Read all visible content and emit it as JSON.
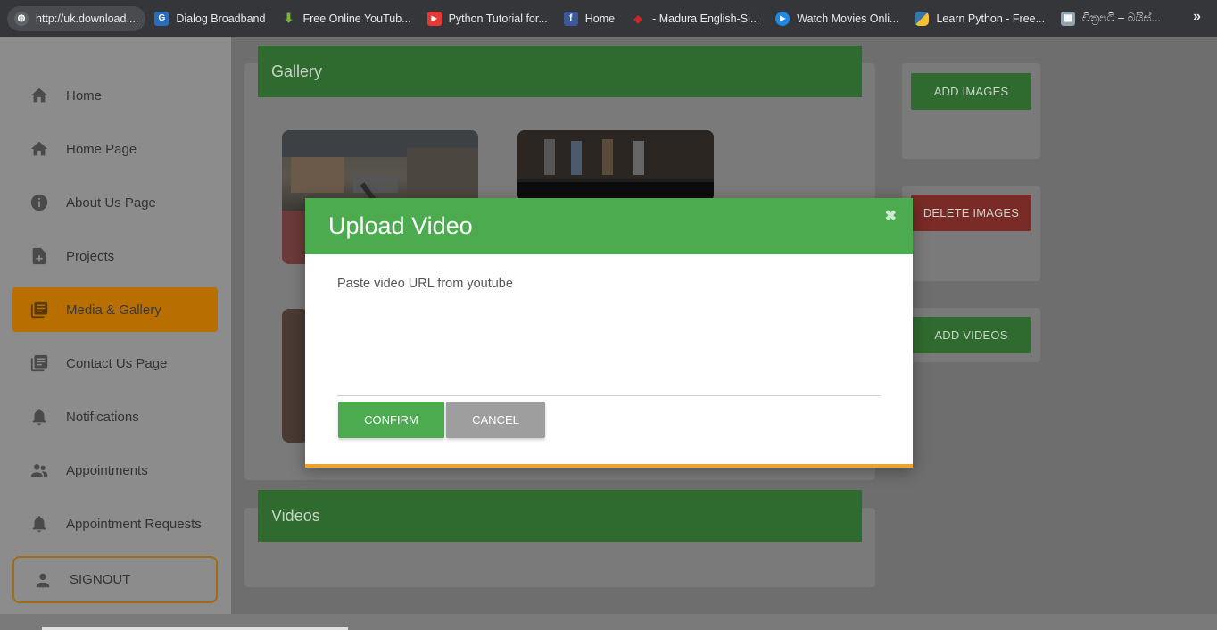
{
  "bookmarks": [
    {
      "label": "http://uk.download....",
      "icon": "globe-icon",
      "color": "#5f6368"
    },
    {
      "label": "Dialog Broadband",
      "icon": "dialog-icon",
      "color": "#2a6ebb"
    },
    {
      "label": "Free Online YouTub...",
      "icon": "download-arrow-icon",
      "color": "#7cb342"
    },
    {
      "label": "Python Tutorial for...",
      "icon": "youtube-icon",
      "color": "#e53935"
    },
    {
      "label": "Home",
      "icon": "facebook-icon",
      "color": "#3b5998"
    },
    {
      "label": "- Madura English-Si...",
      "icon": "madura-icon",
      "color": "#c62828"
    },
    {
      "label": "Watch Movies Onli...",
      "icon": "play-circle-icon",
      "color": "#1e88e5"
    },
    {
      "label": "Learn Python - Free...",
      "icon": "python-icon",
      "color": "#fbc02d"
    },
    {
      "label": "චිත්‍රපටි – බයිස්...",
      "icon": "film-icon",
      "color": "#90a4ae"
    }
  ],
  "bookmarks_more": "»",
  "sidebar": {
    "items": [
      {
        "label": "Home",
        "icon": "home-icon"
      },
      {
        "label": "Home Page",
        "icon": "home-icon"
      },
      {
        "label": "About Us Page",
        "icon": "info-icon"
      },
      {
        "label": "Projects",
        "icon": "file-plus-icon"
      },
      {
        "label": "Media & Gallery",
        "icon": "library-icon",
        "active": true
      },
      {
        "label": "Contact Us Page",
        "icon": "library-icon"
      },
      {
        "label": "Notifications",
        "icon": "bell-icon"
      },
      {
        "label": "Appointments",
        "icon": "people-icon"
      },
      {
        "label": "Appointment Requests",
        "icon": "bell-icon"
      }
    ],
    "signout": {
      "label": "SIGNOUT",
      "icon": "person-icon"
    }
  },
  "gallery": {
    "title": "Gallery"
  },
  "videos": {
    "title": "Videos"
  },
  "actions": {
    "add_images": "ADD IMAGES",
    "delete_images": "DELETE IMAGES",
    "add_videos": "ADD VIDEOS"
  },
  "modal": {
    "title": "Upload Video",
    "close": "✖",
    "label": "Paste video URL from youtube",
    "input_value": "",
    "confirm": "CONFIRM",
    "cancel": "CANCEL"
  },
  "colors": {
    "accent_green": "#4caa4f",
    "accent_orange": "#f2a02a",
    "danger_red": "#e53935"
  }
}
